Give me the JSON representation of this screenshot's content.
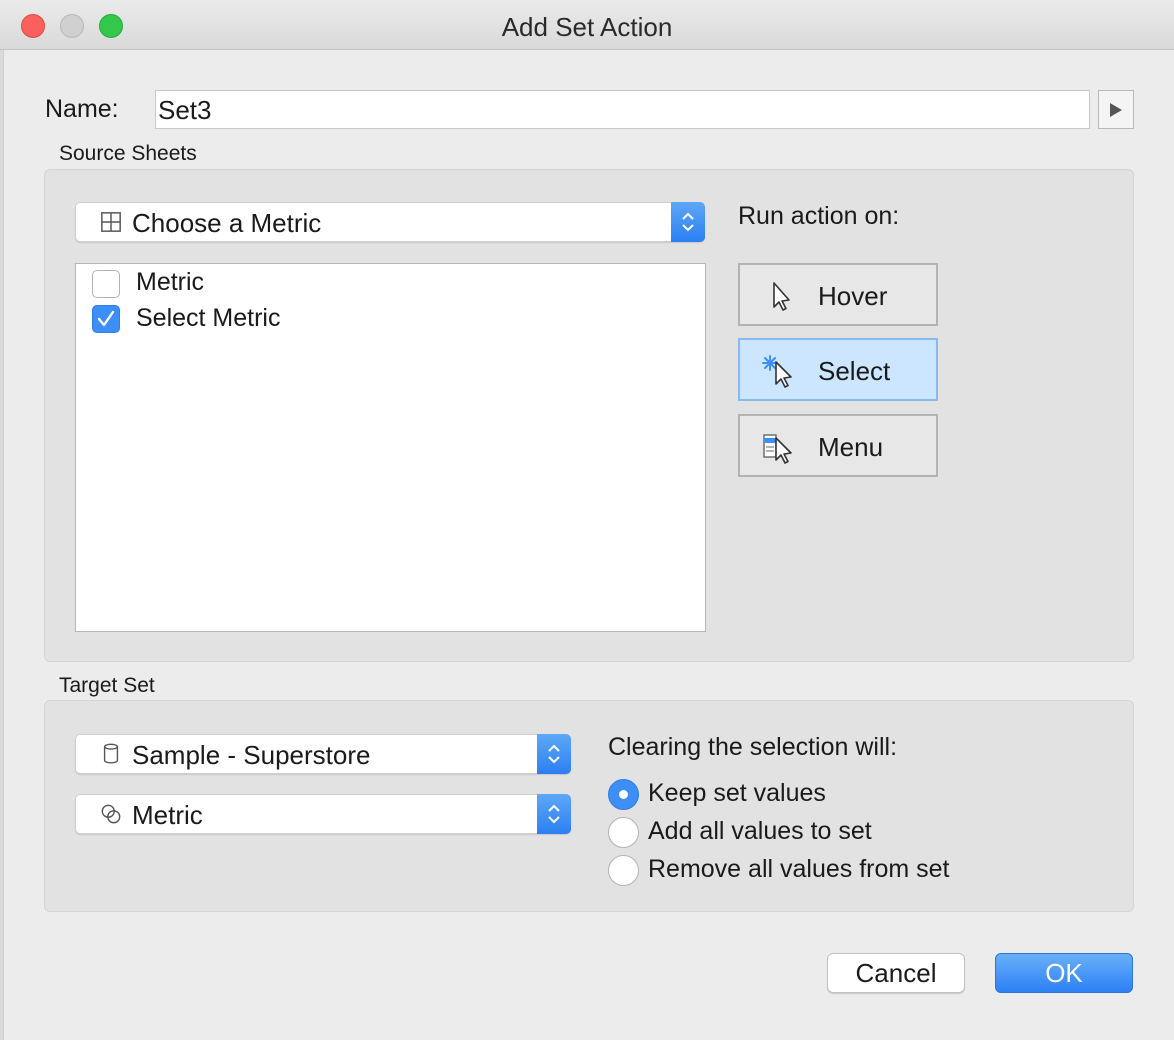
{
  "window": {
    "title": "Add Set Action"
  },
  "name": {
    "label": "Name:",
    "value": "Set3"
  },
  "source_sheets": {
    "label": "Source Sheets",
    "sheet_dropdown": {
      "value": "Choose a Metric",
      "icon": "grid-icon"
    },
    "items": [
      {
        "label": "Metric",
        "checked": false
      },
      {
        "label": "Select Metric",
        "checked": true
      }
    ]
  },
  "run_action": {
    "label": "Run action on:",
    "options": [
      {
        "label": "Hover",
        "icon": "cursor-icon",
        "selected": false
      },
      {
        "label": "Select",
        "icon": "select-cursor-icon",
        "selected": true
      },
      {
        "label": "Menu",
        "icon": "menu-cursor-icon",
        "selected": false
      }
    ]
  },
  "target_set": {
    "label": "Target Set",
    "datasource_dropdown": {
      "value": "Sample - Superstore",
      "icon": "database-icon"
    },
    "set_dropdown": {
      "value": "Metric",
      "icon": "set-icon"
    }
  },
  "clearing": {
    "label": "Clearing the selection will:",
    "options": [
      {
        "label": "Keep set values",
        "selected": true
      },
      {
        "label": "Add all values to set",
        "selected": false
      },
      {
        "label": "Remove all values from set",
        "selected": false
      }
    ]
  },
  "buttons": {
    "cancel": "Cancel",
    "ok": "OK"
  },
  "colors": {
    "accent": "#3e8ef7",
    "selected_button": "#cce6ff"
  }
}
